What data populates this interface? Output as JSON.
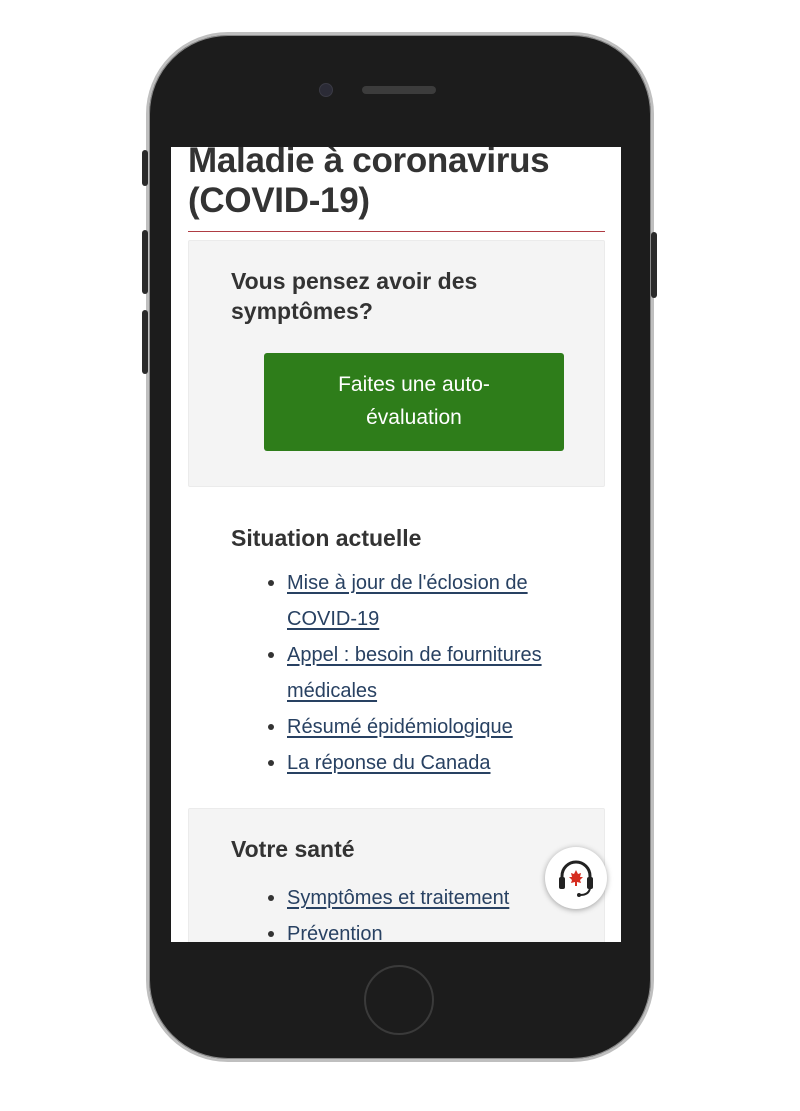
{
  "page": {
    "title": "Maladie à coronavirus (COVID-19)"
  },
  "symptoms_card": {
    "heading": "Vous pensez avoir des symptômes?",
    "cta_label": "Faites une auto-évaluation"
  },
  "situation": {
    "heading": "Situation actuelle",
    "links": [
      "Mise à jour de l'éclosion de COVID-19",
      "Appel : besoin de fournitures médicales",
      "Résumé épidémiologique",
      "La réponse du Canada"
    ]
  },
  "health": {
    "heading": "Votre santé",
    "links": [
      "Symptômes et traitement",
      "Prévention"
    ]
  },
  "chat": {
    "icon": "headset-maple-leaf-icon"
  },
  "colors": {
    "cta_green": "#2e7d1a",
    "link_blue": "#284162",
    "title_rule": "#af3c43",
    "card_bg": "#f4f4f4",
    "maple_red": "#d52b1e"
  }
}
